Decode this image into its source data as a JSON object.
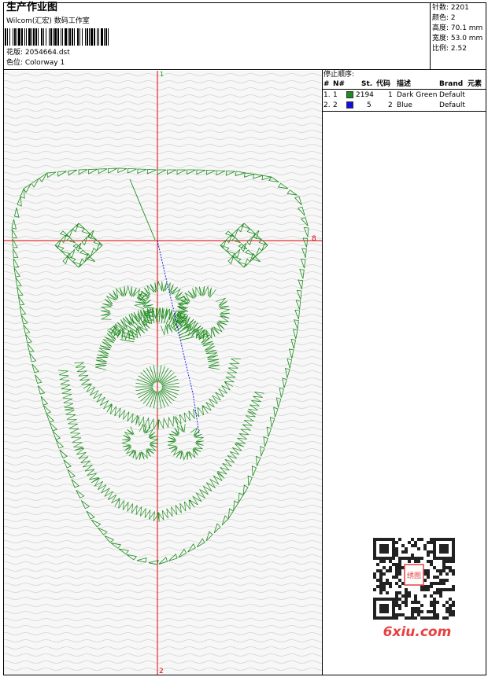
{
  "header": {
    "title": "生产作业图",
    "company": "Wilcom(汇宏) 数码工作室",
    "design_label": "花版: 2054664.dst",
    "colorway_label": "色位: Colorway 1"
  },
  "stats": {
    "stitches": "针数: 2201",
    "colors": "颜色: 2",
    "height": "高度: 70.1 mm",
    "width": "宽度: 53.0 mm",
    "scale": "比例: 2.52"
  },
  "stop_sequence": {
    "title": "停止顺序:",
    "headers": [
      "#",
      "N#",
      "St.",
      "代码",
      "描述",
      "Brand",
      "元素"
    ],
    "rows": [
      {
        "idx": "1.",
        "n": "1",
        "stitches": "2194",
        "code": "1",
        "desc": "Dark Green",
        "brand": "Default",
        "color": "#1e8c1e"
      },
      {
        "idx": "2.",
        "n": "2",
        "stitches": "5",
        "code": "2",
        "desc": "Blue",
        "brand": "Default",
        "color": "#1010e0"
      }
    ]
  },
  "markers": {
    "top": "1",
    "bottom": "2",
    "right": "8"
  },
  "watermark": {
    "text": "6xiu.com",
    "seal_text": "绣图"
  },
  "colors": {
    "stitch_green": "#1e8c1e",
    "jump_blue": "#1010e0",
    "axis_red": "#e00000",
    "watermark_red": "#e84040"
  }
}
